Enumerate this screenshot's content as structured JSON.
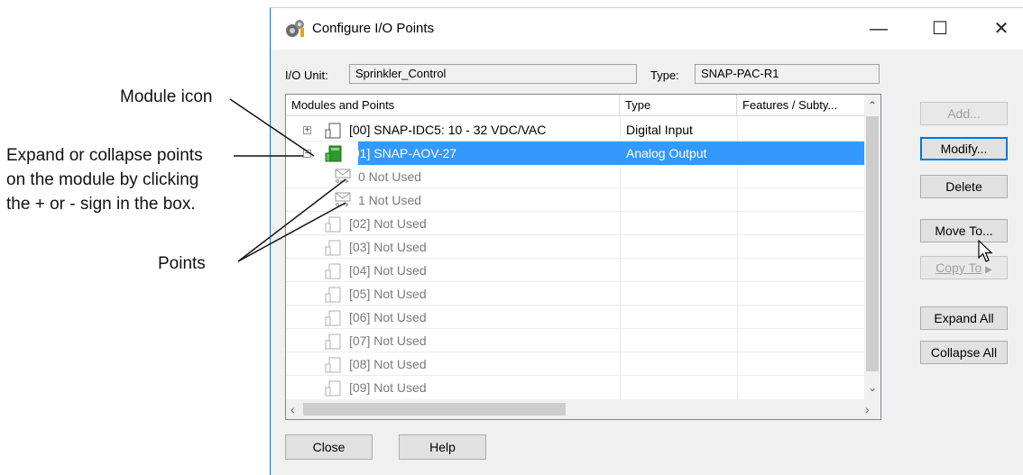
{
  "annotations": {
    "module_icon": "Module icon",
    "expand_line1": "Expand or collapse points",
    "expand_line2": "on the module by clicking",
    "expand_line3": "the + or - sign in the box.",
    "points": "Points"
  },
  "window": {
    "title": "Configure I/O Points",
    "controls": {
      "minimize": "—",
      "maximize": "☐",
      "close": "✕"
    }
  },
  "io_unit": {
    "label": "I/O Unit:",
    "value": "Sprinkler_Control"
  },
  "type_field": {
    "label": "Type:",
    "value": "SNAP-PAC-R1"
  },
  "list": {
    "columns": [
      "Modules and Points",
      "Type",
      "Features / Subty..."
    ],
    "rows": [
      {
        "label": "[00] SNAP-IDC5: 10 - 32 VDC/VAC",
        "type": "Digital Input",
        "expander": "+"
      },
      {
        "label": "[01] SNAP-AOV-27",
        "type": "Analog Output",
        "expander": "−",
        "selected": true
      },
      {
        "label": "0  Not Used",
        "type": ""
      },
      {
        "label": "1  Not Used",
        "type": ""
      },
      {
        "label": "[02] Not Used",
        "type": ""
      },
      {
        "label": "[03] Not Used",
        "type": ""
      },
      {
        "label": "[04] Not Used",
        "type": ""
      },
      {
        "label": "[05] Not Used",
        "type": ""
      },
      {
        "label": "[06] Not Used",
        "type": ""
      },
      {
        "label": "[07] Not Used",
        "type": ""
      },
      {
        "label": "[08] Not Used",
        "type": ""
      },
      {
        "label": "[09] Not Used",
        "type": ""
      }
    ]
  },
  "buttons": {
    "add": "Add...",
    "modify": "Modify...",
    "delete": "Delete",
    "move_to": "Move To...",
    "copy_to": "Copy To",
    "expand_all": "Expand All",
    "collapse_all": "Collapse All",
    "close": "Close",
    "help": "Help"
  },
  "colors": {
    "selection": "#3399ff",
    "module_green": "#2e9a2e",
    "window_border": "#1e6fd0"
  }
}
